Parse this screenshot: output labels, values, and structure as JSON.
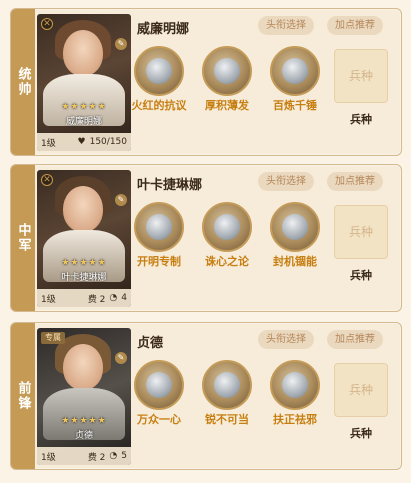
{
  "generals": [
    {
      "position": "统帅",
      "name": "威廉明娜",
      "portrait_name": "威廉明娜",
      "stars": "★★★★★",
      "level": "1级",
      "stat": "150/150",
      "tag": "",
      "skills": [
        {
          "label": "火红的抗议"
        },
        {
          "label": "厚积薄发"
        },
        {
          "label": "百炼千锤"
        }
      ]
    },
    {
      "position": "中军",
      "name": "叶卡捷琳娜",
      "portrait_name": "叶卡捷琳娜",
      "stars": "★★★★★",
      "level": "1级",
      "stat": "费 2",
      "stat_extra": "4",
      "tag": "",
      "skills": [
        {
          "label": "开明专制"
        },
        {
          "label": "诛心之论"
        },
        {
          "label": "封机锢能"
        }
      ]
    },
    {
      "position": "前锋",
      "name": "贞德",
      "portrait_name": "贞德",
      "stars": "★★★★★",
      "level": "1级",
      "stat": "费 2",
      "stat_extra": "5",
      "tag": "专属",
      "skills": [
        {
          "label": "万众一心"
        },
        {
          "label": "锐不可当"
        },
        {
          "label": "扶正祛邪"
        }
      ]
    }
  ],
  "buttons": {
    "title_select": "头衔选择",
    "points_recommend": "加点推荐"
  },
  "troop": {
    "slot_text": "兵种",
    "label": "兵种"
  },
  "colors": {
    "accent": "#c59a55",
    "skill_text": "#c87f12",
    "panel_bg": "#f6ecd9"
  }
}
